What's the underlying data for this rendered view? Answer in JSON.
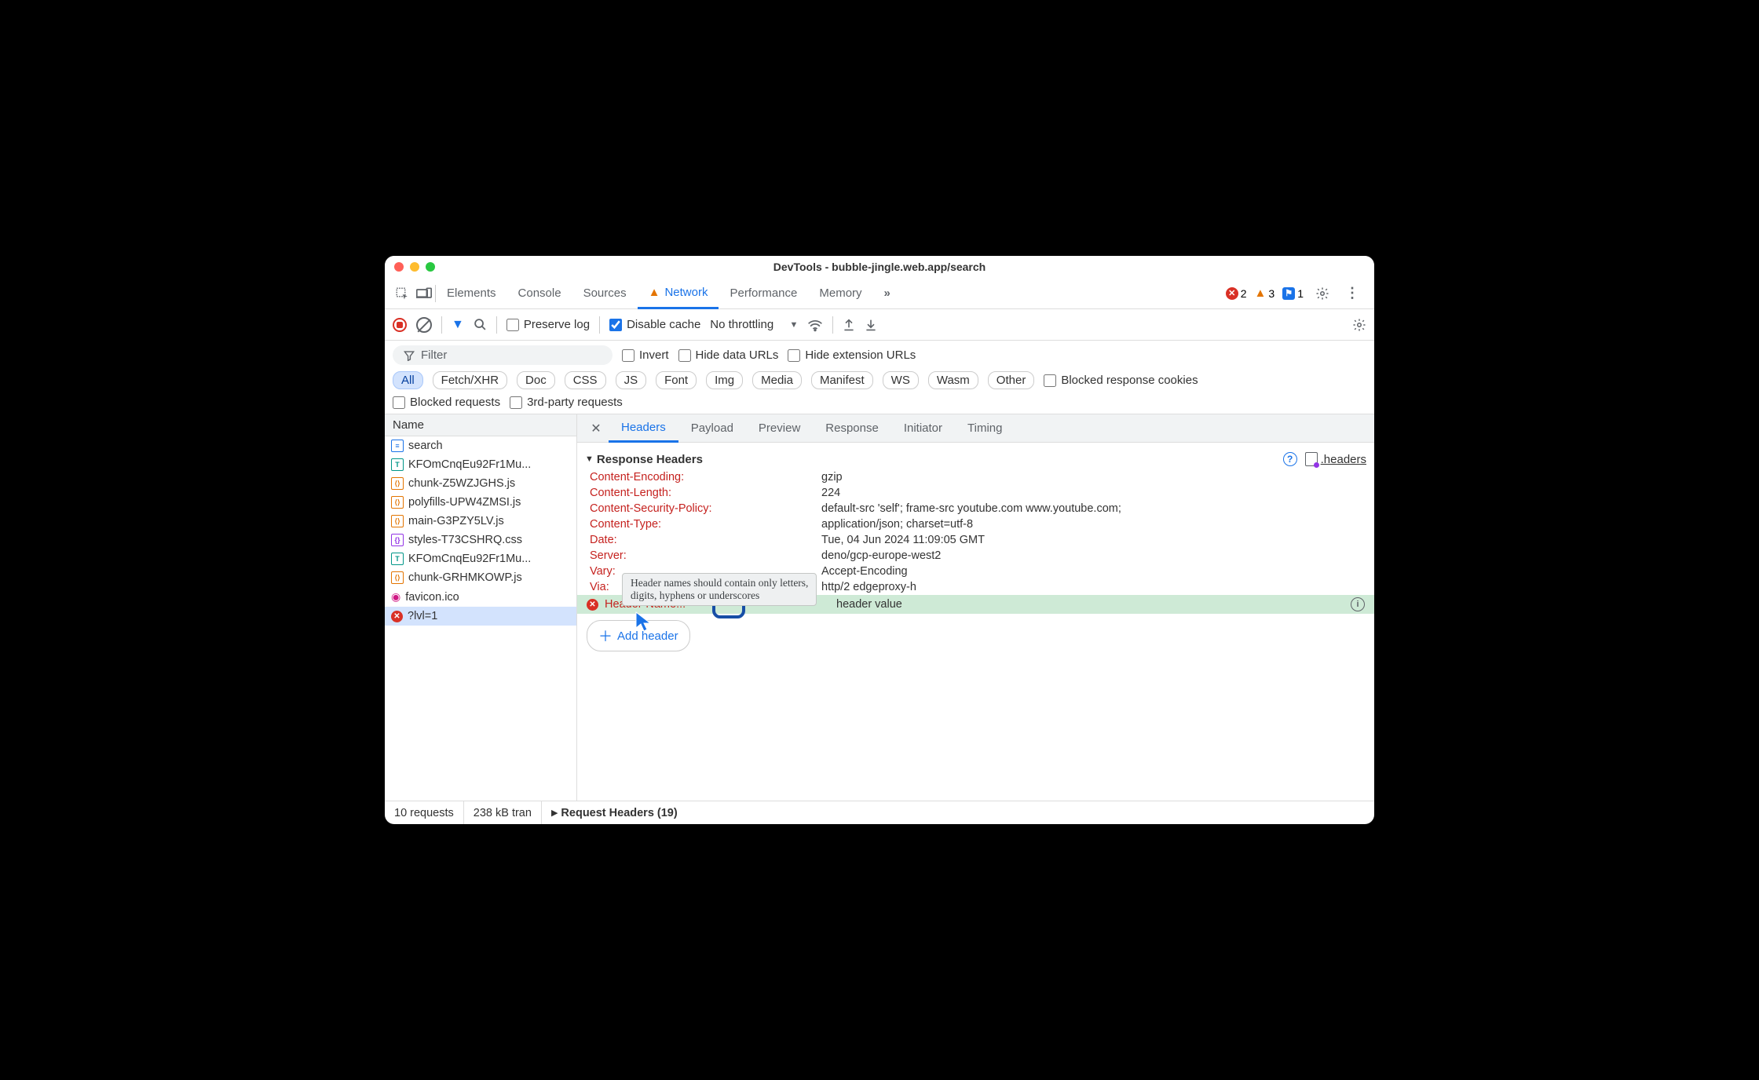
{
  "window": {
    "title": "DevTools - bubble-jingle.web.app/search"
  },
  "tabs": {
    "items": [
      "Elements",
      "Console",
      "Sources",
      "Network",
      "Performance",
      "Memory"
    ],
    "active_index": 3,
    "errors_count": "2",
    "warnings_count": "3",
    "issues_count": "1"
  },
  "toolbar": {
    "preserve_log": "Preserve log",
    "disable_cache": "Disable cache",
    "throttling": "No throttling"
  },
  "filterbar": {
    "filter_placeholder": "Filter",
    "invert": "Invert",
    "hide_data": "Hide data URLs",
    "hide_ext": "Hide extension URLs",
    "types": [
      "All",
      "Fetch/XHR",
      "Doc",
      "CSS",
      "JS",
      "Font",
      "Img",
      "Media",
      "Manifest",
      "WS",
      "Wasm",
      "Other"
    ],
    "blocked_cookies": "Blocked response cookies",
    "blocked_requests": "Blocked requests",
    "third_party": "3rd-party requests"
  },
  "requests": {
    "col_name": "Name",
    "items": [
      {
        "name": "search",
        "type": "doc"
      },
      {
        "name": "KFOmCnqEu92Fr1Mu...",
        "type": "font"
      },
      {
        "name": "chunk-Z5WZJGHS.js",
        "type": "js"
      },
      {
        "name": "polyfills-UPW4ZMSI.js",
        "type": "js"
      },
      {
        "name": "main-G3PZY5LV.js",
        "type": "js"
      },
      {
        "name": "styles-T73CSHRQ.css",
        "type": "css"
      },
      {
        "name": "KFOmCnqEu92Fr1Mu...",
        "type": "font"
      },
      {
        "name": "chunk-GRHMKOWP.js",
        "type": "js"
      },
      {
        "name": "favicon.ico",
        "type": "ico"
      },
      {
        "name": "?lvl=1",
        "type": "err"
      }
    ],
    "selected_index": 9
  },
  "subtabs": {
    "items": [
      "Headers",
      "Payload",
      "Preview",
      "Response",
      "Initiator",
      "Timing"
    ],
    "active_index": 0
  },
  "response_headers": {
    "title": "Response Headers",
    "headers_link": ".headers",
    "rows": [
      {
        "name": "Content-Encoding:",
        "value": "gzip"
      },
      {
        "name": "Content-Length:",
        "value": "224"
      },
      {
        "name": "Content-Security-Policy:",
        "value": "default-src 'self'; frame-src youtube.com www.youtube.com;"
      },
      {
        "name": "Content-Type:",
        "value": "application/json; charset=utf-8"
      },
      {
        "name": "Date:",
        "value": "Tue, 04 Jun 2024 11:09:05 GMT"
      },
      {
        "name": "Server:",
        "value": "deno/gcp-europe-west2"
      },
      {
        "name": "Vary:",
        "value": "Accept-Encoding"
      },
      {
        "name": "Via:",
        "value": "http/2 edgeproxy-h"
      }
    ],
    "new_header": {
      "name": "Header-Name!!!",
      "value": "header value"
    },
    "tooltip": "Header names should contain only letters,\ndigits, hyphens or underscores",
    "add_header": "Add header"
  },
  "request_headers": {
    "title": "Request Headers (19)"
  },
  "footer": {
    "requests": "10 requests",
    "transferred": "238 kB tran"
  }
}
